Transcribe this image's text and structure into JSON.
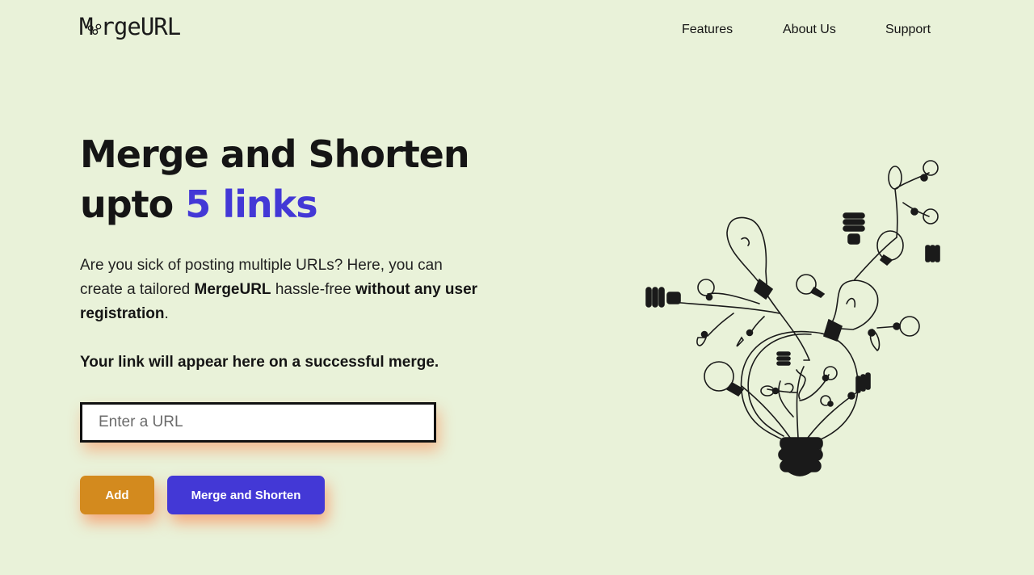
{
  "brand": {
    "logo_text": "rgeURL",
    "logo_m": "M"
  },
  "nav": {
    "items": [
      "Features",
      "About Us",
      "Support"
    ]
  },
  "hero": {
    "line1": "Merge and Shorten",
    "line2_prefix": "upto ",
    "line2_accent": "5 links"
  },
  "description": {
    "part1": "Are you sick of posting multiple URLs? Here, you can create a tailored ",
    "bold1": "MergeURL",
    "part2": " hassle-free ",
    "bold2": "without any user registration",
    "part3": "."
  },
  "status_message": "Your link will appear here on a successful merge.",
  "url_input": {
    "placeholder": "Enter a URL",
    "value": ""
  },
  "buttons": {
    "add": "Add",
    "merge": "Merge and Shorten"
  },
  "colors": {
    "background": "#e9f2d9",
    "accent": "#4338d6",
    "add_button": "#d38a1e",
    "glow": "#ff7a3c"
  },
  "illustration": {
    "icon": "lightbulb-tree-icon"
  }
}
